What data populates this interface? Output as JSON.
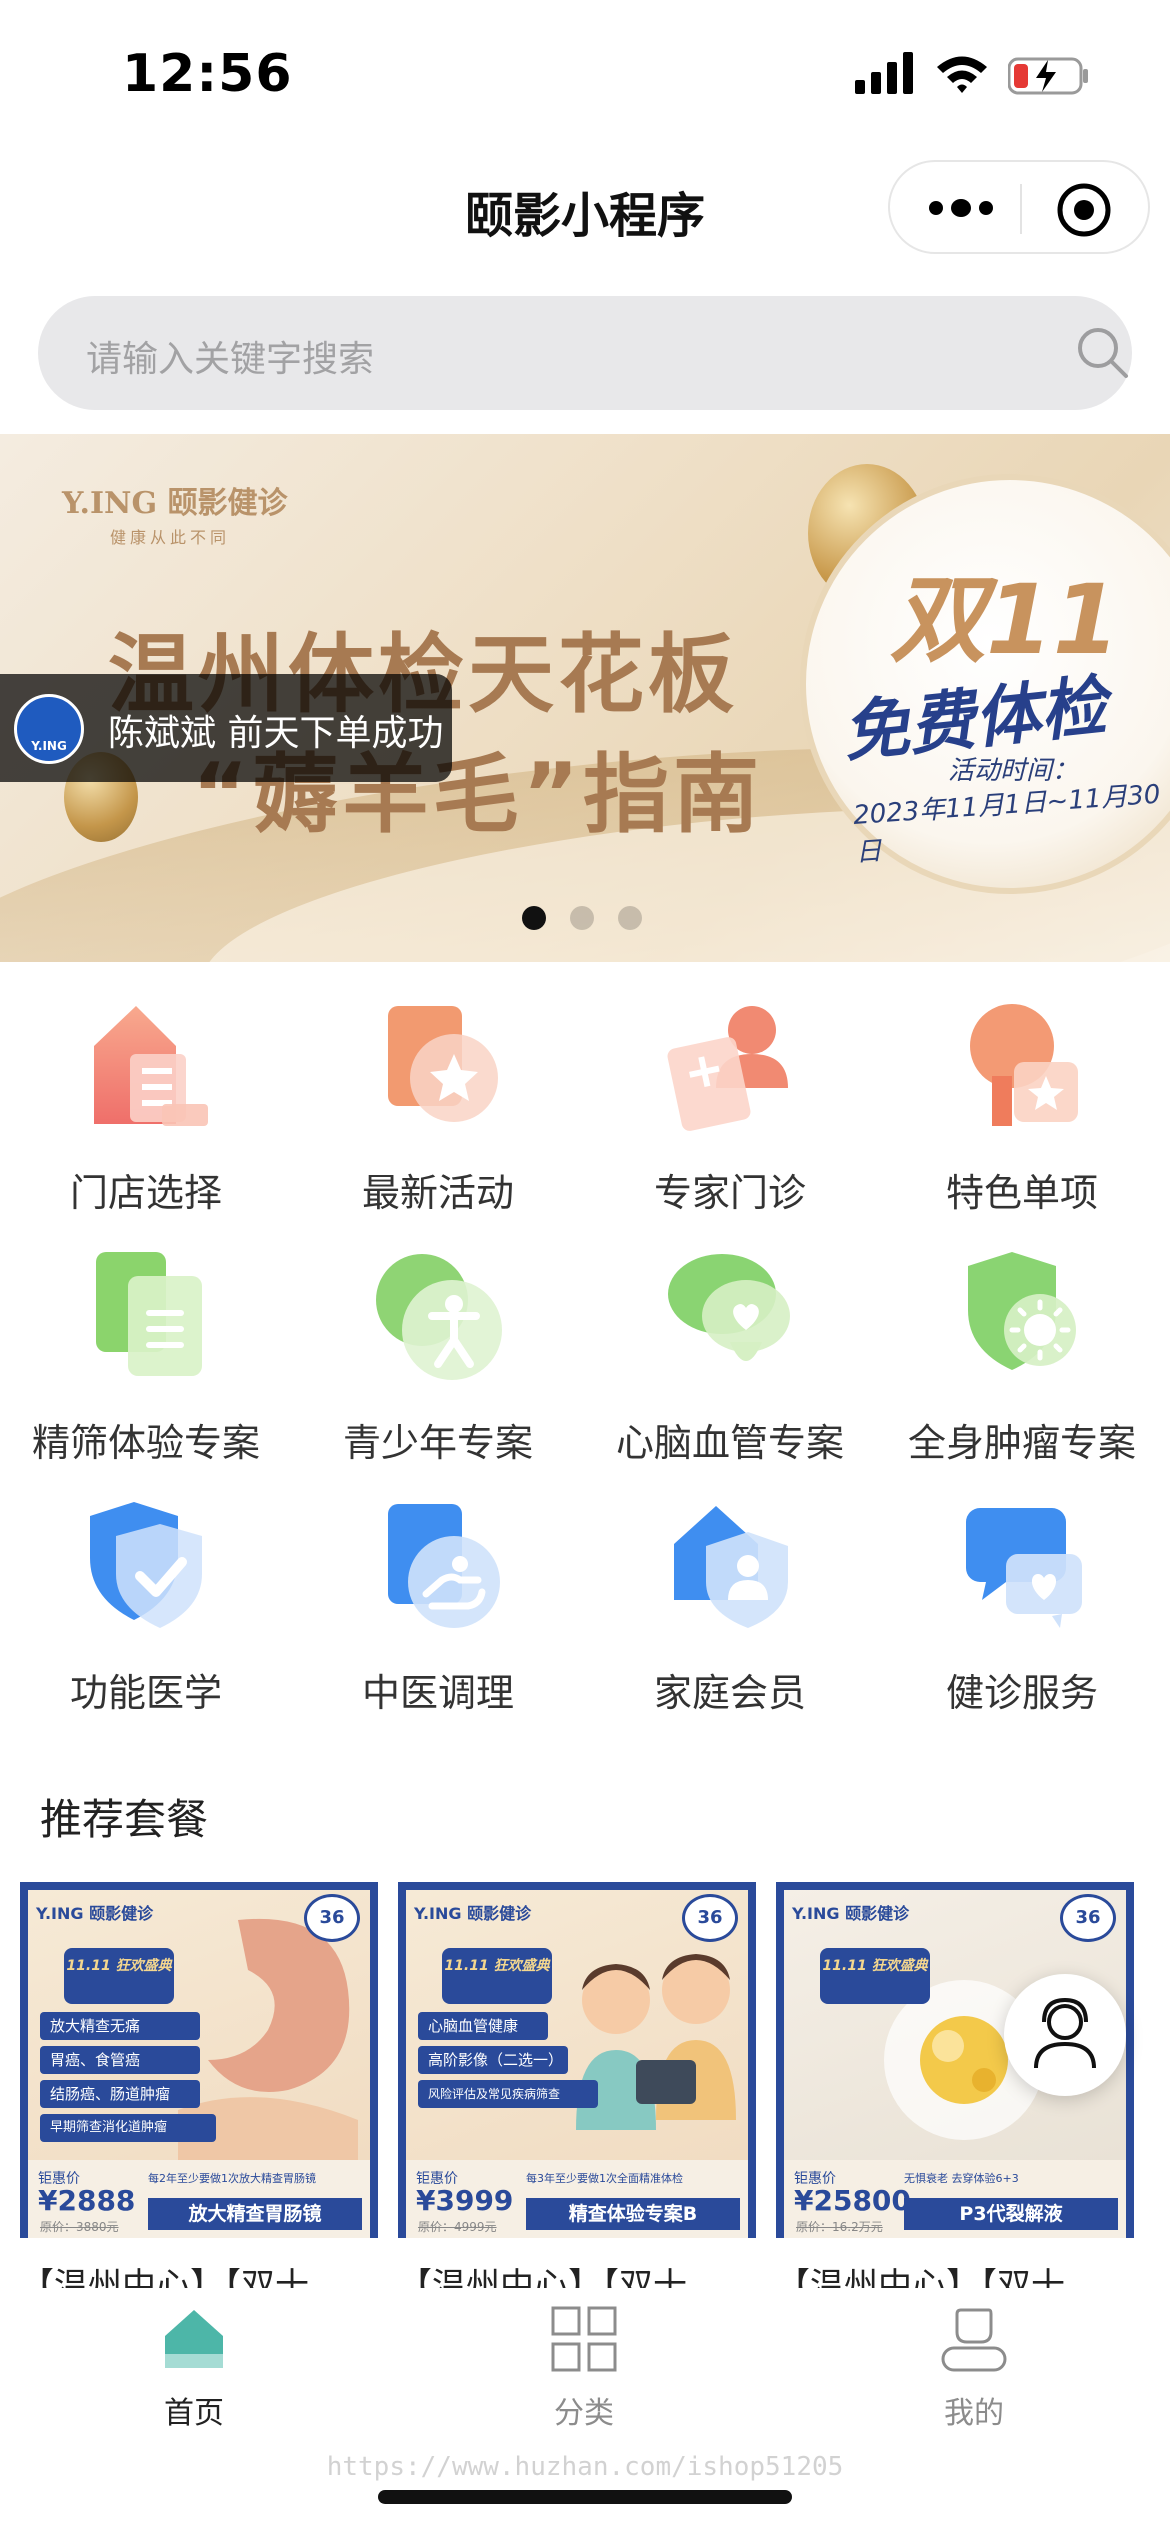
{
  "status_bar": {
    "time": "12:56"
  },
  "nav": {
    "title": "颐影小程序"
  },
  "search": {
    "placeholder": "请输入关键字搜索"
  },
  "banner": {
    "brand": "Y.ING 颐影健诊",
    "brand_sub": "健康从此不同",
    "headline_1": "温州体检天花板",
    "headline_2": "“薅羊毛”指南",
    "badge_title": "双11",
    "badge_subtitle": "免费体检",
    "activity_label": "活动时间：",
    "activity_date": "2023年11月1日~11月30日",
    "toast_avatar_text": "Y.ING",
    "toast_text": "陈斌斌 前天下单成功",
    "slides": 3,
    "active_slide": 1
  },
  "menu": [
    {
      "label": "门店选择",
      "icon": "store-icon"
    },
    {
      "label": "最新活动",
      "icon": "activity-icon"
    },
    {
      "label": "专家门诊",
      "icon": "expert-clinic-icon"
    },
    {
      "label": "特色单项",
      "icon": "special-item-icon"
    },
    {
      "label": "精筛体验专案",
      "icon": "document-icon"
    },
    {
      "label": "青少年专案",
      "icon": "youth-icon"
    },
    {
      "label": "心脑血管专案",
      "icon": "brain-heart-icon"
    },
    {
      "label": "全身肿瘤专案",
      "icon": "tumor-shield-icon"
    },
    {
      "label": "功能医学",
      "icon": "shield-check-icon"
    },
    {
      "label": "中医调理",
      "icon": "tcm-hand-icon"
    },
    {
      "label": "家庭会员",
      "icon": "family-member-icon"
    },
    {
      "label": "健诊服务",
      "icon": "chat-heart-icon"
    }
  ],
  "recommend": {
    "title": "推荐套餐",
    "cards": [
      {
        "logo": "Y.ING 颐影健诊",
        "seal": "36",
        "promo": "11.11 狂欢盛典",
        "bullets": [
          "放大精查无痛",
          "胃癌、食管癌",
          "结肠癌、肠道肿瘤",
          "早期筛查消化道肿瘤"
        ],
        "price_label": "钜惠价",
        "price": "¥2888",
        "orig_price": "原价：3880元",
        "note": "每2年至少要做1次放大精查胃肠镜",
        "product": "放大精查胃肠镜",
        "name": "【温州中心】【双十"
      },
      {
        "logo": "Y.ING 颐影健诊",
        "seal": "36",
        "promo": "11.11 狂欢盛典",
        "bullets": [
          "心脑血管健康",
          "高阶影像（二选一）",
          "风险评估及常见疾病筛查"
        ],
        "price_label": "钜惠价",
        "price": "¥3999",
        "orig_price": "原价：4999元",
        "note": "每3年至少要做1次全面精准体检",
        "product": "精查体验专案B",
        "name": "【温州中心】【双十"
      },
      {
        "logo": "Y.ING 颐影健诊",
        "seal": "36",
        "promo": "11.11 狂欢盛典",
        "bullets": [],
        "price_label": "钜惠价",
        "price": "¥25800",
        "orig_price": "原价：16.2万元",
        "note": "无惧衰老  去穿体验6+3",
        "product": "P3代裂解液",
        "name": "【温州中心】【双十"
      }
    ]
  },
  "tabbar": [
    {
      "label": "首页",
      "icon": "home-icon",
      "active": true
    },
    {
      "label": "分类",
      "icon": "grid-icon",
      "active": false
    },
    {
      "label": "我的",
      "icon": "profile-icon",
      "active": false
    }
  ],
  "watermark": "https://www.huzhan.com/ishop51205",
  "colors": {
    "accent": "#4db6a8",
    "brand_blue": "#2a4a9a",
    "gold": "#a77a52",
    "tab_inactive": "#8c8c8c"
  }
}
